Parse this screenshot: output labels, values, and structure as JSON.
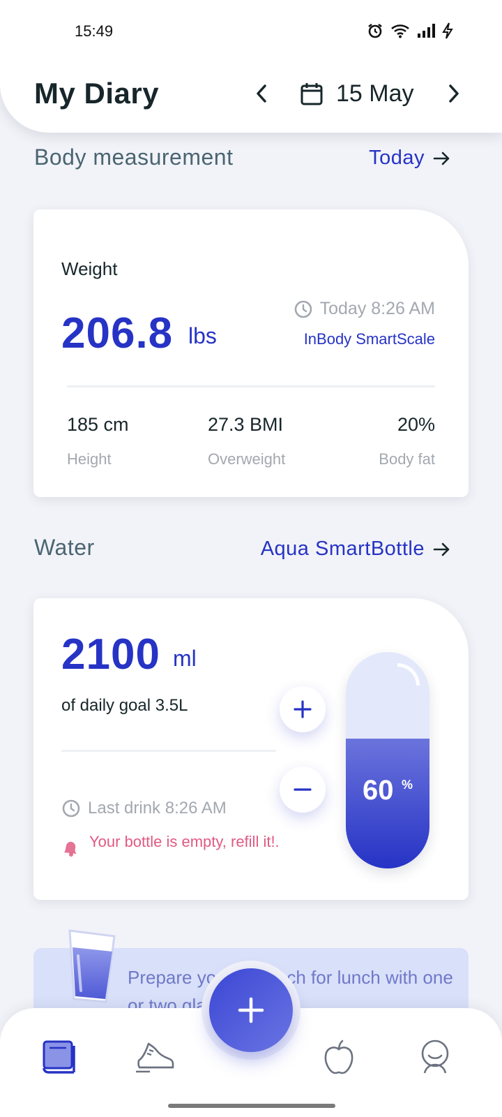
{
  "status_bar": {
    "time": "15:49"
  },
  "header": {
    "title": "My Diary",
    "date": "15 May"
  },
  "body_measurement": {
    "title": "Body measurement",
    "link": "Today",
    "weight_label": "Weight",
    "weight_value": "206.8",
    "weight_unit": "lbs",
    "timestamp": "Today 8:26 AM",
    "device": "InBody SmartScale",
    "stats": [
      {
        "value": "185 cm",
        "label": "Height"
      },
      {
        "value": "27.3 BMI",
        "label": "Overweight"
      },
      {
        "value": "20%",
        "label": "Body fat"
      }
    ]
  },
  "water": {
    "title": "Water",
    "link": "Aqua SmartBottle",
    "amount": "2100",
    "unit": "ml",
    "goal_text": "of daily goal 3.5L",
    "last_drink": "Last drink 8:26 AM",
    "warning": "Your bottle is empty, refill it!.",
    "percent": "60",
    "percent_sign": "%",
    "fill_fraction": 0.6
  },
  "tip": {
    "text": "Prepare your stomach for lunch with one or two glass of water"
  },
  "colors": {
    "accent": "#2633c5",
    "warning": "#e05a83",
    "muted": "#a3a8b0",
    "background": "#f2f3f8"
  },
  "bottom_nav": {
    "items": [
      {
        "icon": "diary-icon",
        "active": true
      },
      {
        "icon": "shoe-icon",
        "active": false
      },
      {
        "icon": "add-icon",
        "active": false
      },
      {
        "icon": "apple-icon",
        "active": false
      },
      {
        "icon": "profile-icon",
        "active": false
      }
    ]
  }
}
